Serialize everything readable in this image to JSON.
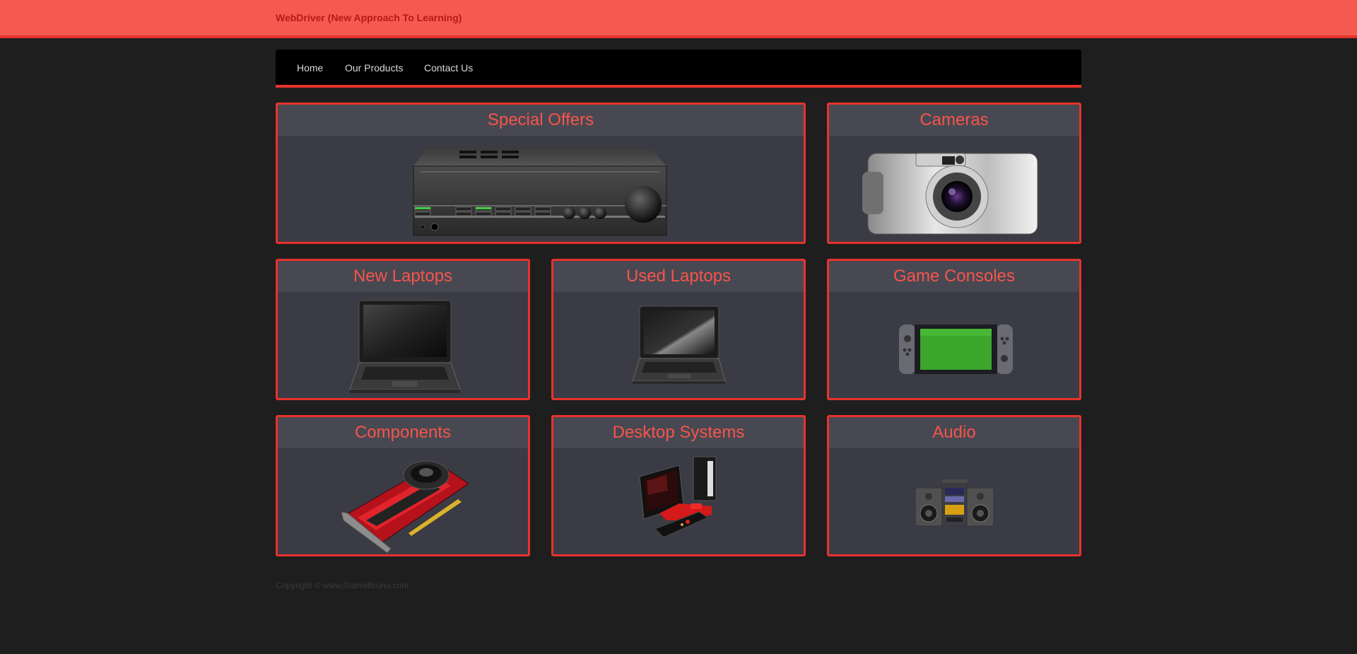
{
  "header": {
    "brand": "WebDriver (New Approach To Learning)"
  },
  "nav": {
    "items": [
      "Home",
      "Our Products",
      "Contact Us"
    ]
  },
  "tiles": [
    {
      "title": "Special Offers",
      "icon": "amplifier-icon"
    },
    {
      "title": "Cameras",
      "icon": "camera-icon"
    },
    {
      "title": "New Laptops",
      "icon": "laptop-icon"
    },
    {
      "title": "Used Laptops",
      "icon": "laptop-icon"
    },
    {
      "title": "Game Consoles",
      "icon": "game-console-icon"
    },
    {
      "title": "Components",
      "icon": "graphics-card-icon"
    },
    {
      "title": "Desktop Systems",
      "icon": "desktop-computer-icon"
    },
    {
      "title": "Audio",
      "icon": "boombox-icon"
    }
  ],
  "footer": {
    "copyright": "Copyright © www.GianniBruno.com"
  },
  "colors": {
    "accent": "#e7332b",
    "header": "#f55a51",
    "tile_bg": "#3b3b45",
    "title": "#f5554b"
  }
}
